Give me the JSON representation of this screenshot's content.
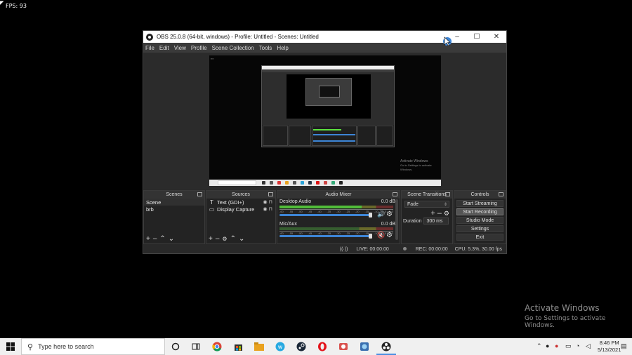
{
  "desktop": {
    "fps": "FPS: 93",
    "activate_title": "Activate Windows",
    "activate_sub": "Go to Settings to activate Windows."
  },
  "window": {
    "title": "OBS 25.0.8 (64-bit, windows) - Profile: Untitled - Scenes: Untitled",
    "minimize": "–",
    "maximize": "☐",
    "close": "✕"
  },
  "menu": [
    "File",
    "Edit",
    "View",
    "Profile",
    "Scene Collection",
    "Tools",
    "Help"
  ],
  "preview": {
    "activate_title": "Activate Windows",
    "activate_sub": "Go to Settings to activate Windows."
  },
  "scenes": {
    "title": "Scenes",
    "items": [
      "Scene",
      "brb"
    ]
  },
  "sources": {
    "title": "Sources",
    "items": [
      {
        "icon": "text-icon",
        "glyph": "T",
        "label": "Text (GDI+)"
      },
      {
        "icon": "monitor-icon",
        "glyph": "▭",
        "label": "Display Capture"
      }
    ]
  },
  "mixer": {
    "title": "Audio Mixer",
    "channels": [
      {
        "name": "Desktop Audio",
        "db": "0.0 dB",
        "level": 0.72,
        "muted": false
      },
      {
        "name": "Mic/Aux",
        "db": "0.0 dB",
        "level": 0.0,
        "muted": true
      }
    ],
    "ticks": [
      "-60",
      "-55",
      "-50",
      "-45",
      "-40",
      "-35",
      "-30",
      "-25",
      "-20",
      "-15",
      "-10",
      "-5",
      "0"
    ]
  },
  "transitions": {
    "title": "Scene Transitions",
    "selected": "Fade",
    "duration_label": "Duration",
    "duration_value": "300 ms"
  },
  "controls": {
    "title": "Controls",
    "buttons": [
      "Start Streaming",
      "Start Recording",
      "Studio Mode",
      "Settings",
      "Exit"
    ]
  },
  "status": {
    "live": "LIVE: 00:00:00",
    "rec": "REC: 00:00:00",
    "cpu": "CPU: 5.3%, 30.00 fps"
  },
  "taskbar": {
    "search_placeholder": "Type here to search",
    "time": "8:46 PM",
    "date": "5/13/2021"
  },
  "colors": {
    "accent": "#3d85d6",
    "meter_green": "#5de33f",
    "muted_red": "#e33333"
  }
}
